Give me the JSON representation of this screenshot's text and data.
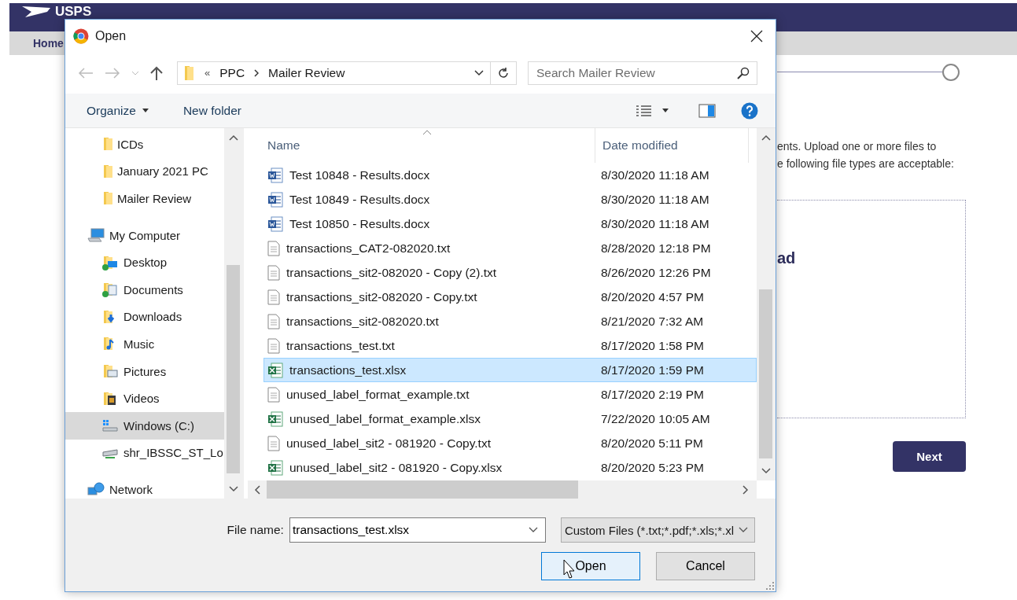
{
  "page": {
    "logo": "USPS",
    "nav": [
      "Home"
    ],
    "intro_lines": [
      "ents. Upload one or more files to",
      "e following file types are acceptable:"
    ],
    "dropzone_title": "ad",
    "next_button": "Next"
  },
  "dialog": {
    "title": "Open",
    "address": {
      "overflow": "«",
      "segments": [
        "PPC",
        "Mailer Review"
      ]
    },
    "search": {
      "placeholder": "Search Mailer Review"
    },
    "toolbar": {
      "organize": "Organize",
      "new_folder": "New folder"
    },
    "sidebar": {
      "pinned": [
        {
          "label": "ICDs",
          "kind": "folder",
          "selected": false
        },
        {
          "label": "January 2021 PC",
          "kind": "folder",
          "selected": false
        },
        {
          "label": "Mailer Review",
          "kind": "folder",
          "selected": false
        }
      ],
      "groups": [
        {
          "label": "My Computer",
          "kind": "computer",
          "selected": false,
          "children": [
            {
              "label": "Desktop",
              "kind": "desktop",
              "selected": false
            },
            {
              "label": "Documents",
              "kind": "documents",
              "selected": false
            },
            {
              "label": "Downloads",
              "kind": "downloads",
              "selected": false
            },
            {
              "label": "Music",
              "kind": "music",
              "selected": false
            },
            {
              "label": "Pictures",
              "kind": "pictures",
              "selected": false
            },
            {
              "label": "Videos",
              "kind": "videos",
              "selected": false
            },
            {
              "label": "Windows (C:)",
              "kind": "drive",
              "selected": true
            },
            {
              "label": "shr_IBSSC_ST_Lo",
              "kind": "netdrive",
              "selected": false
            }
          ]
        },
        {
          "label": "Network",
          "kind": "network",
          "selected": false
        }
      ]
    },
    "columns": [
      "Name",
      "Date modified"
    ],
    "files": [
      {
        "name": "Test 10848 - Results.docx",
        "kind": "word",
        "date": "8/30/2020 11:18 AM",
        "selected": false
      },
      {
        "name": "Test 10849 - Results.docx",
        "kind": "word",
        "date": "8/30/2020 11:18 AM",
        "selected": false
      },
      {
        "name": "Test 10850 - Results.docx",
        "kind": "word",
        "date": "8/30/2020 11:18 AM",
        "selected": false
      },
      {
        "name": "transactions_CAT2-082020.txt",
        "kind": "text",
        "date": "8/28/2020 12:18 PM",
        "selected": false
      },
      {
        "name": "transactions_sit2-082020 - Copy (2).txt",
        "kind": "text",
        "date": "8/26/2020 12:26 PM",
        "selected": false
      },
      {
        "name": "transactions_sit2-082020 - Copy.txt",
        "kind": "text",
        "date": "8/20/2020 4:57 PM",
        "selected": false
      },
      {
        "name": "transactions_sit2-082020.txt",
        "kind": "text",
        "date": "8/21/2020 7:32 AM",
        "selected": false
      },
      {
        "name": "transactions_test.txt",
        "kind": "text",
        "date": "8/17/2020 1:58 PM",
        "selected": false
      },
      {
        "name": "transactions_test.xlsx",
        "kind": "excel",
        "date": "8/17/2020 1:59 PM",
        "selected": true
      },
      {
        "name": "unused_label_format_example.txt",
        "kind": "text",
        "date": "8/17/2020 2:19 PM",
        "selected": false
      },
      {
        "name": "unused_label_format_example.xlsx",
        "kind": "excel",
        "date": "7/22/2020 10:05 AM",
        "selected": false
      },
      {
        "name": "unused_label_sit2 - 081920 - Copy.txt",
        "kind": "text",
        "date": "8/20/2020 5:11 PM",
        "selected": false
      },
      {
        "name": "unused_label_sit2 - 081920 - Copy.xlsx",
        "kind": "excel",
        "date": "8/20/2020 5:23 PM",
        "selected": false
      }
    ],
    "file_name": {
      "label": "File name:",
      "value": "transactions_test.xlsx"
    },
    "file_type": "Custom Files (*.txt;*.pdf;*.xls;*.xl",
    "buttons": [
      {
        "label": "Open",
        "kind": "primary"
      },
      {
        "label": "Cancel",
        "kind": "secondary"
      }
    ]
  }
}
